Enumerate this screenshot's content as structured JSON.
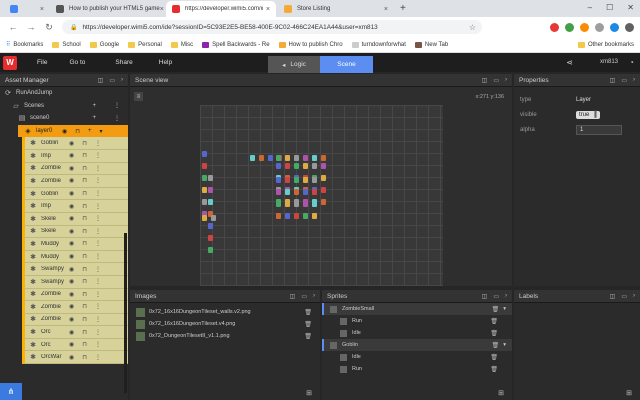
{
  "browser": {
    "tabs": [
      {
        "label": "",
        "color": "#4285f4"
      },
      {
        "label": "How to publish your HTML5 game",
        "color": "#555555"
      },
      {
        "label": "https://developer.wimi5.com/ide",
        "color": "#e52d2d"
      },
      {
        "label": "Store Listing",
        "color": "#f4a938"
      }
    ],
    "tab_close": "×",
    "new_tab": "+",
    "window_controls": [
      "–",
      "☐",
      "✕"
    ],
    "url": "https://developer.wimi5.com/ide?sessionID=5C93E2E5-BE58-400E-9C02-466C24EA1A44&user=xm813",
    "star": "☆",
    "bookmarks": [
      "Bookmarks",
      "School",
      "Google",
      "Personal",
      "Misc",
      "Spell Backwards - Re",
      "How to publish Chro",
      "turndownforwhat",
      "New Tab"
    ],
    "other_bookmarks": "Other bookmarks"
  },
  "app": {
    "logo": "W",
    "menu": [
      "File",
      "Go to",
      "Share",
      "Help"
    ],
    "toggle": {
      "logic": "Logic",
      "scene": "Scene"
    },
    "user": "xm813"
  },
  "asset_manager": {
    "title": "Asset Manager",
    "project": "RunAndJump",
    "scenes_label": "Scenes",
    "scene": "scene0",
    "layer": "layer0",
    "objects": [
      "Goblin",
      "Imp",
      "Zombie",
      "Zombie",
      "Goblin",
      "Imp",
      "Skele",
      "Skele",
      "Muddy",
      "Muddy",
      "Swampy",
      "Swampy",
      "Zombie",
      "Zombie",
      "Zombie",
      "Orc",
      "Orc",
      "OrcWar"
    ]
  },
  "scene_view": {
    "title": "Scene view",
    "coords": "x:271  y:136"
  },
  "properties": {
    "title": "Properties",
    "rows": [
      {
        "label": "type",
        "value": "Layer"
      },
      {
        "label": "visible",
        "value": "true"
      },
      {
        "label": "alpha",
        "value": "1"
      }
    ]
  },
  "images": {
    "title": "Images",
    "files": [
      "0x72_16x16DungeonTileset_walls.v2.png",
      "0x72_16x16DungeonTileset.v4.png",
      "0x72_DungeonTilesetII_v1.1.png"
    ]
  },
  "sprites": {
    "title": "Sprites",
    "groups": [
      {
        "name": "ZombieSmall",
        "anims": [
          "Run",
          "Idle"
        ]
      },
      {
        "name": "Goblin",
        "anims": [
          "Idle",
          "Run"
        ]
      }
    ]
  },
  "labels": {
    "title": "Labels"
  },
  "colors": {
    "accent": "#5b8ef0",
    "layer": "#f39c12",
    "logo": "#e52d2d"
  }
}
